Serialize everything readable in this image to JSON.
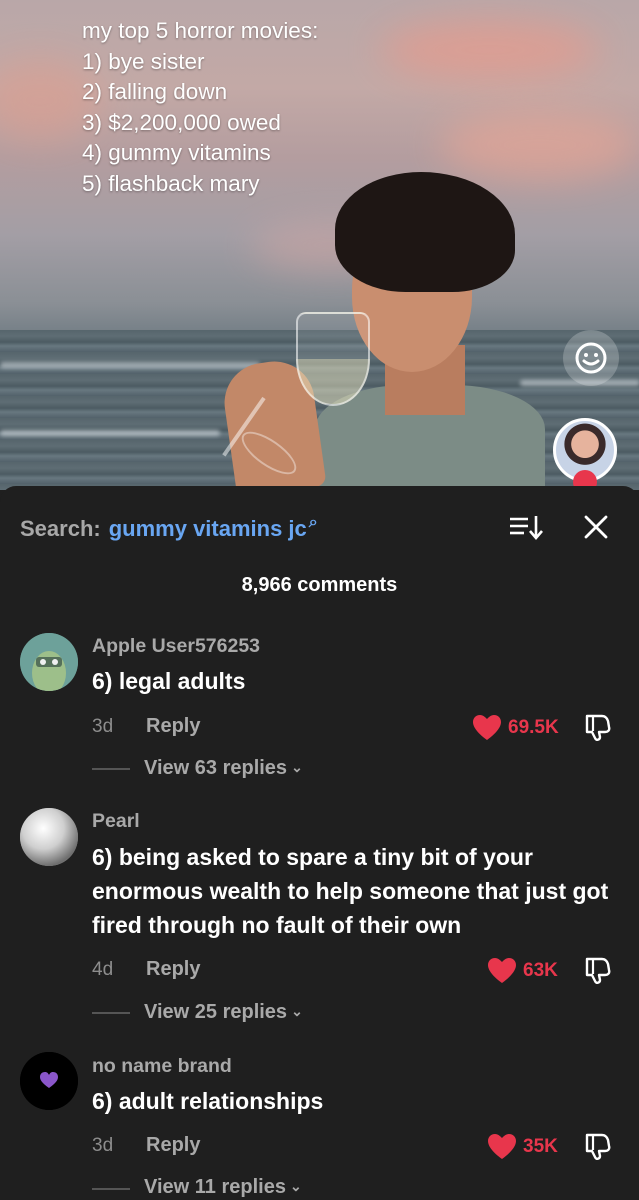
{
  "video": {
    "overlay_lines": [
      "my top 5 horror movies:",
      "1) bye sister",
      "2) falling down",
      "3) $2,200,000 owed",
      "4) gummy vitamins",
      "5) flashback mary"
    ],
    "icons": {
      "effect": "face-smile-icon",
      "creator": "creator-avatar"
    }
  },
  "panel": {
    "search_label": "Search:",
    "search_term": "gummy vitamins jc",
    "search_glyph": "⌕",
    "comment_count": "8,966 comments",
    "icons": {
      "sort": "sort-icon",
      "close": "close-icon"
    }
  },
  "comments": [
    {
      "username": "Apple User576253",
      "text": "6) legal adults",
      "age": "3d",
      "reply_label": "Reply",
      "likes": "69.5K",
      "view_replies": "View 63 replies",
      "avatar": "green-creature-avatar"
    },
    {
      "username": "Pearl",
      "text": "6) being asked to spare a tiny bit of your enormous wealth to help someone that just got fired through no fault of their own",
      "age": "4d",
      "reply_label": "Reply",
      "likes": "63K",
      "view_replies": "View 25 replies",
      "avatar": "pearl-avatar"
    },
    {
      "username": "no name brand",
      "text": "6) adult relationships",
      "age": "3d",
      "reply_label": "Reply",
      "likes": "35K",
      "view_replies": "View 11 replies",
      "avatar": "purple-heart-avatar"
    }
  ],
  "colors": {
    "accent_like": "#e8364c",
    "search_term": "#69a6f2",
    "panel_bg": "#1f1f1f"
  }
}
